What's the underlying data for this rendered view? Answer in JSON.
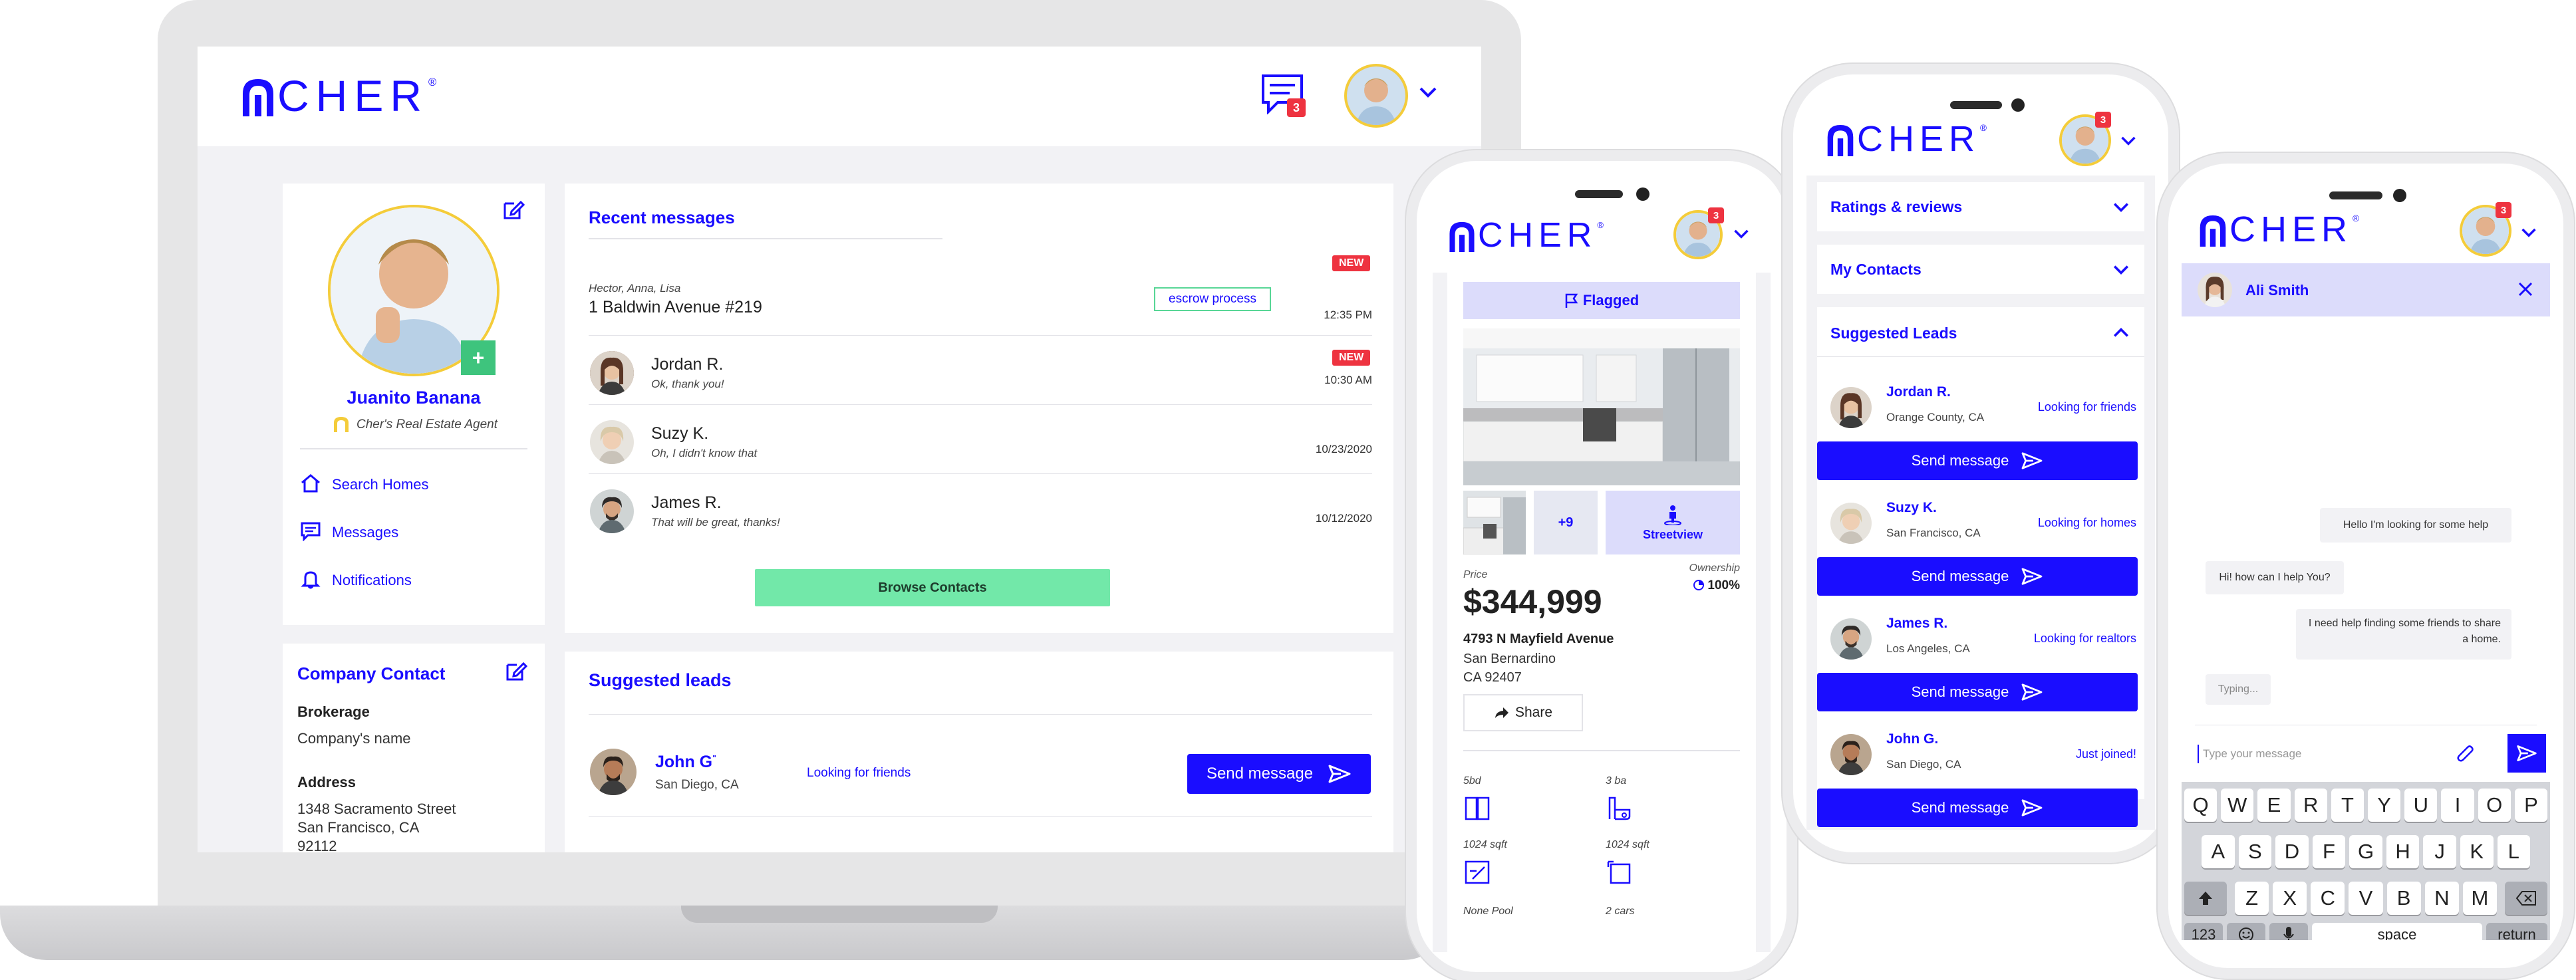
{
  "brand": {
    "name": "CHER",
    "reg": "®",
    "color": "#1a0dff"
  },
  "laptop": {
    "header": {
      "message_badge": "3"
    },
    "profile": {
      "name": "Juanito Banana",
      "role": "Cher's Real Estate Agent",
      "nav": [
        {
          "label": "Search Homes",
          "icon": "home-icon"
        },
        {
          "label": "Messages",
          "icon": "message-icon"
        },
        {
          "label": "Notifications",
          "icon": "bell-icon"
        }
      ]
    },
    "company": {
      "title": "Company Contact",
      "brokerage_label": "Brokerage",
      "brokerage_value": "Company's name",
      "address_label": "Address",
      "address_lines": [
        "1348 Sacramento Street",
        "San Francisco, CA",
        "92112"
      ]
    },
    "recent": {
      "title": "Recent messages",
      "items": [
        {
          "sender": "Hector, Anna, Lisa",
          "title": "1 Baldwin Avenue #219",
          "tag": "escrow process",
          "new": "NEW",
          "time": "12:35 PM"
        },
        {
          "sender": "Jordan R.",
          "text": "Ok, thank you!",
          "new": "NEW",
          "time": "10:30 AM"
        },
        {
          "sender": "Suzy K.",
          "text": "Oh, I didn't know that",
          "time": "10/23/2020"
        },
        {
          "sender": "James R.",
          "text": "That will be great, thanks!",
          "time": "10/12/2020"
        }
      ],
      "browse": "Browse Contacts"
    },
    "leads": {
      "title": "Suggested leads",
      "item": {
        "name": "John G",
        "location": "San Diego, CA",
        "status": "Looking for friends",
        "button": "Send message"
      }
    }
  },
  "phone1": {
    "badge": "3",
    "flagged": "Flagged",
    "more_photos": "+9",
    "streetview": "Streetview",
    "price_label": "Price",
    "price": "$344,999",
    "ownership_label": "Ownership",
    "ownership_value": "100%",
    "address1": "4793 N Mayfield Avenue",
    "address2": "San Bernardino",
    "address3": "CA 92407",
    "share": "Share",
    "features": [
      {
        "label": "5bd",
        "icon": "door-icon"
      },
      {
        "label": "3 ba",
        "icon": "bath-icon"
      },
      {
        "label": "1024 sqft",
        "icon": "floorplan-icon"
      },
      {
        "label": "1024 sqft",
        "icon": "lot-icon"
      },
      {
        "label": "None Pool",
        "icon": "pool-icon"
      },
      {
        "label": "2 cars",
        "icon": "car-icon"
      }
    ]
  },
  "phone2": {
    "badge": "3",
    "sections": [
      "Ratings & reviews",
      "My Contacts",
      "Suggested Leads"
    ],
    "leads": [
      {
        "name": "Jordan R.",
        "location": "Orange County, CA",
        "status": "Looking for friends"
      },
      {
        "name": "Suzy K.",
        "location": "San Francisco, CA",
        "status": "Looking for homes"
      },
      {
        "name": "James R.",
        "location": "Los Angeles, CA",
        "status": "Looking for realtors"
      },
      {
        "name": "John G.",
        "location": "San Diego, CA",
        "status": "Just joined!"
      }
    ],
    "send": "Send message"
  },
  "phone3": {
    "badge": "3",
    "contact": "Ali Smith",
    "messages": [
      {
        "from": "me",
        "text": "Hello I'm looking for some help"
      },
      {
        "from": "them",
        "text": "Hi! how can I help You?"
      },
      {
        "from": "me",
        "text": "I need help finding some friends to share a home."
      },
      {
        "from": "them",
        "text": "Typing..."
      }
    ],
    "placeholder": "Type your message",
    "keyboard": {
      "row1": [
        "Q",
        "W",
        "E",
        "R",
        "T",
        "Y",
        "U",
        "I",
        "O",
        "P"
      ],
      "row2": [
        "A",
        "S",
        "D",
        "F",
        "G",
        "H",
        "J",
        "K",
        "L"
      ],
      "row3": [
        "Z",
        "X",
        "C",
        "V",
        "B",
        "N",
        "M"
      ],
      "num": "123",
      "space": "space",
      "return": "return"
    }
  }
}
